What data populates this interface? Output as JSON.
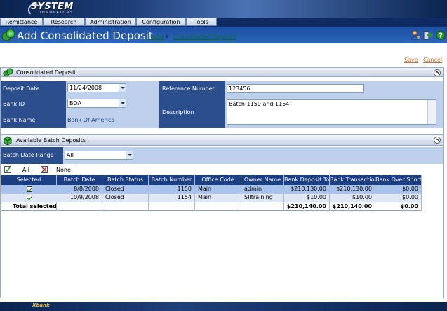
{
  "brand": {
    "name": "SYSTEM",
    "tagline": "INNOVATORS",
    "footer_logo": "Xbank"
  },
  "menu": [
    {
      "label": "Remittance"
    },
    {
      "label": "Research"
    },
    {
      "label": "Administration"
    },
    {
      "label": "Configuration"
    },
    {
      "label": "Tools"
    }
  ],
  "page": {
    "title": "Add Consolidated Deposit"
  },
  "breadcrumb": {
    "home": "Home",
    "current": "Consolidated Deposits"
  },
  "toolbar_icons": [
    "user-settings-icon",
    "logout-icon",
    "help-icon"
  ],
  "actions": {
    "save": "Save",
    "cancel": "Cancel"
  },
  "deposit_section": {
    "title": "Consolidated Deposit",
    "deposit_date_label": "Deposit Date",
    "deposit_date_value": "11/24/2008",
    "reference_number_label": "Reference Number",
    "reference_number_value": "123456",
    "bank_id_label": "Bank ID",
    "bank_id_value": "BOA",
    "description_label": "Description",
    "description_value": "Batch 1150 and 1154",
    "bank_name_label": "Bank Name",
    "bank_name_value": "Bank Of America"
  },
  "batch_section": {
    "title": "Available Batch Deposits",
    "date_range_label": "Batch Date Range",
    "date_range_value": "All",
    "select_all": "All",
    "select_none": "None"
  },
  "table": {
    "columns": [
      "Selected",
      "Batch Date",
      "Batch Status",
      "Batch Number",
      "Office Code",
      "Owner Name",
      "Bank Deposit Total",
      "Bank Transaction",
      "Bank Over Short"
    ],
    "rows": [
      {
        "selected": true,
        "batch_date": "8/8/2008",
        "batch_status": "Closed",
        "batch_number": "1150",
        "office_code": "Main",
        "owner_name": "admin",
        "bank_deposit_total": "$210,130.00",
        "bank_transaction": "$210,130.00",
        "bank_over_short": "$0.00"
      },
      {
        "selected": true,
        "batch_date": "10/9/2008",
        "batch_status": "Closed",
        "batch_number": "1154",
        "office_code": "Main",
        "owner_name": "SIItraining",
        "bank_deposit_total": "$10.00",
        "bank_transaction": "$10.00",
        "bank_over_short": "$0.00"
      }
    ],
    "total_label": "Total selected:",
    "totals": {
      "bank_deposit_total": "$210,140.00",
      "bank_transaction": "$210,140.00",
      "bank_over_short": "$0.00"
    }
  },
  "colors": {
    "header_blue": "#1a3f82",
    "label_blue": "#2b4f8c",
    "field_blue": "#bfd0ec",
    "row_highlight": "#a9c3ec",
    "link_orange": "#d07020",
    "link_green": "#0a6a2a"
  }
}
